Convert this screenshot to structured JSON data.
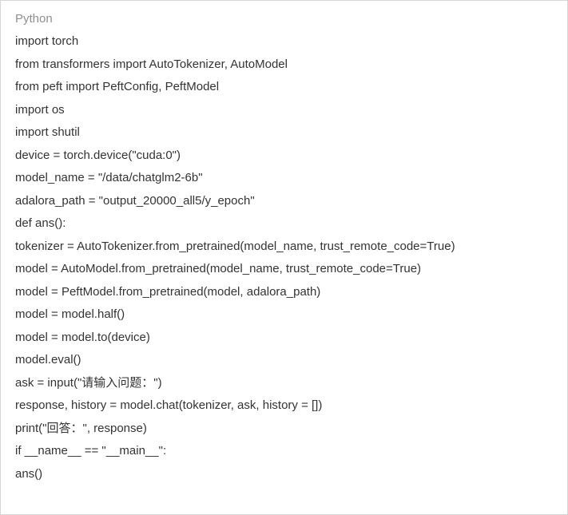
{
  "code_block": {
    "language_label": "Python",
    "lines": [
      "import torch",
      "from transformers import AutoTokenizer, AutoModel",
      "from peft import PeftConfig, PeftModel",
      "import os",
      "import shutil",
      "device = torch.device(\"cuda:0\")",
      "model_name = \"/data/chatglm2-6b\"",
      "adalora_path = \"output_20000_all5/y_epoch\"",
      "def ans():",
      "tokenizer = AutoTokenizer.from_pretrained(model_name, trust_remote_code=True)",
      "model = AutoModel.from_pretrained(model_name, trust_remote_code=True)",
      "model = PeftModel.from_pretrained(model, adalora_path)",
      "model = model.half()",
      "model = model.to(device)",
      "model.eval()",
      "ask = input(\"请输入问题：\")",
      "response, history = model.chat(tokenizer, ask, history = [])",
      "print(\"回答：\", response)",
      "if __name__ == \"__main__\":",
      "ans()"
    ]
  }
}
